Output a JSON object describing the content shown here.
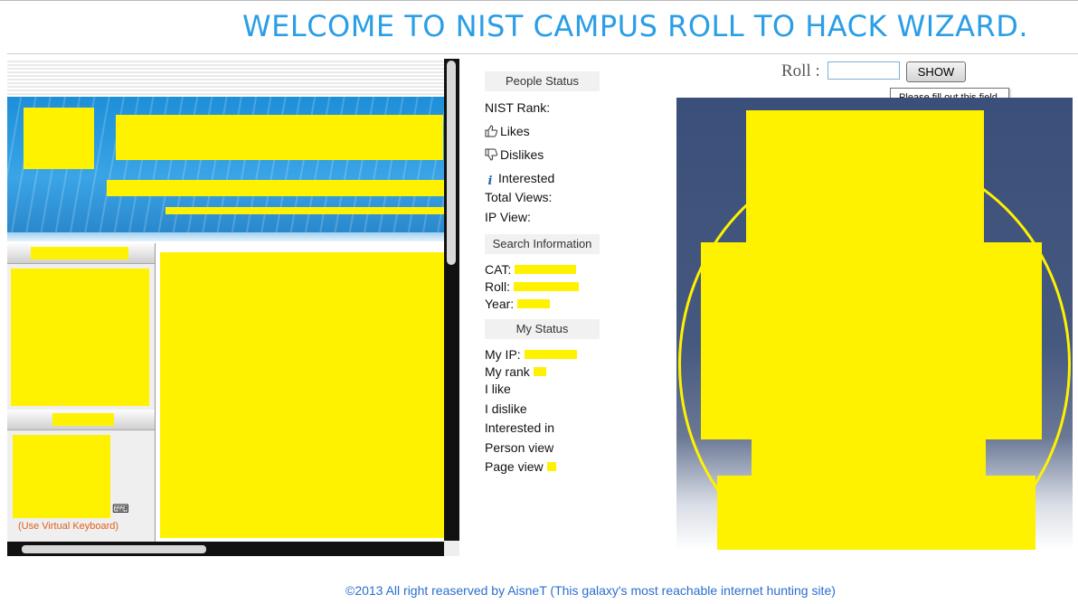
{
  "page": {
    "title": "WELCOME TO NIST CAMPUS ROLL TO HACK WIZARD.",
    "footer": "©2013 All right reaserved by AisneT (This galaxy's most reachable internet hunting site)"
  },
  "left_frame": {
    "virtual_keyboard_link": "(Use Virtual Keyboard)",
    "keyboard_icon": "keyboard-icon"
  },
  "people_status": {
    "heading": "People Status",
    "nist_rank": "NIST Rank:",
    "likes": "Likes",
    "dislikes": "Dislikes",
    "interested": "Interested",
    "total_views": "Total Views:",
    "ip_view": "IP View:",
    "icons": [
      "thumbs-up-icon",
      "thumbs-down-icon",
      "info-icon"
    ]
  },
  "search_information": {
    "heading": "Search Information",
    "cat": "CAT:",
    "roll": "Roll:",
    "year": "Year:"
  },
  "my_status": {
    "heading": "My Status",
    "my_ip": "My IP:",
    "my_rank": "My rank",
    "i_like": "I like",
    "i_dislike": "I dislike",
    "interested_in": "Interested in",
    "person_view": "Person view",
    "page_view": "Page view"
  },
  "roll_form": {
    "label": "Roll :",
    "input_value": "",
    "button_label": "SHOW",
    "validation_tooltip": "Please fill out this field."
  },
  "colors": {
    "title": "#2a9ee6",
    "redaction": "#fff200",
    "footer_link": "#2a6ecf",
    "virtual_keyboard": "#e0601b"
  }
}
